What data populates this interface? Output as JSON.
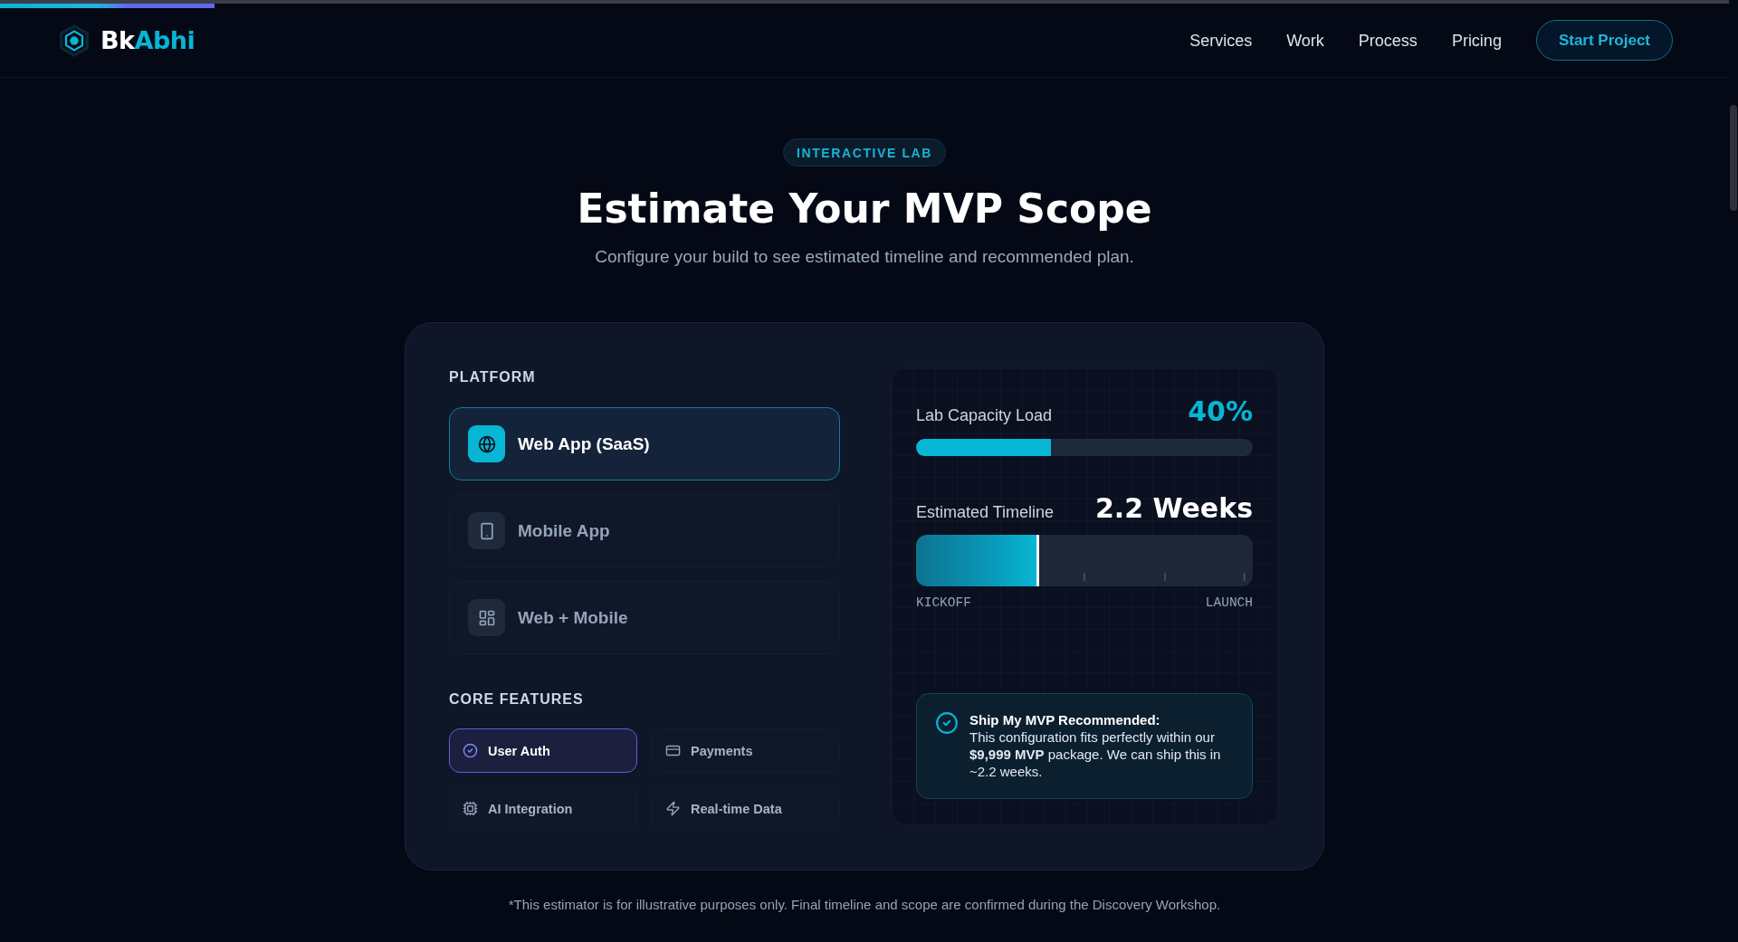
{
  "scroll_progress": {
    "level": 0.124
  },
  "header": {
    "logo": {
      "part_1": "Bk",
      "part_2": "Abhi"
    },
    "nav": [
      {
        "label": "Services"
      },
      {
        "label": "Work"
      },
      {
        "label": "Process"
      },
      {
        "label": "Pricing"
      }
    ],
    "cta": "Start Project"
  },
  "hero": {
    "badge": "INTERACTIVE LAB",
    "title": "Estimate Your MVP Scope",
    "subtitle": "Configure your build to see estimated timeline and recommended plan."
  },
  "estimator": {
    "platform": {
      "heading": "PLATFORM",
      "options": [
        {
          "label": "Web App (SaaS)",
          "kind": "web",
          "selected": true
        },
        {
          "label": "Mobile App",
          "kind": "mobile",
          "selected": false
        },
        {
          "label": "Web + Mobile",
          "kind": "hybrid",
          "selected": false
        }
      ]
    },
    "features": {
      "heading": "CORE FEATURES",
      "items": [
        {
          "label": "User Auth",
          "kind": "auth",
          "selected": true
        },
        {
          "label": "Payments",
          "kind": "payments",
          "selected": false
        },
        {
          "label": "AI Integration",
          "kind": "ai",
          "selected": false
        },
        {
          "label": "Real-time Data",
          "kind": "realtime",
          "selected": false
        }
      ]
    },
    "capacity": {
      "label": "Lab Capacity Load",
      "value": "40%",
      "level": 0.4
    },
    "timeline": {
      "label": "Estimated Timeline",
      "value": "2.2 Weeks",
      "level": 0.365,
      "start": "KICKOFF",
      "end": "LAUNCH"
    },
    "recommendation": {
      "title": "Ship My MVP Recommended:",
      "text": "This configuration fits perfectly within our **$9,999 MVP** package. We can ship this in ~2.2 weeks."
    }
  },
  "disclaimer": "*This estimator is for illustrative purposes only. Final timeline and scope are confirmed during the Discovery Workshop."
}
